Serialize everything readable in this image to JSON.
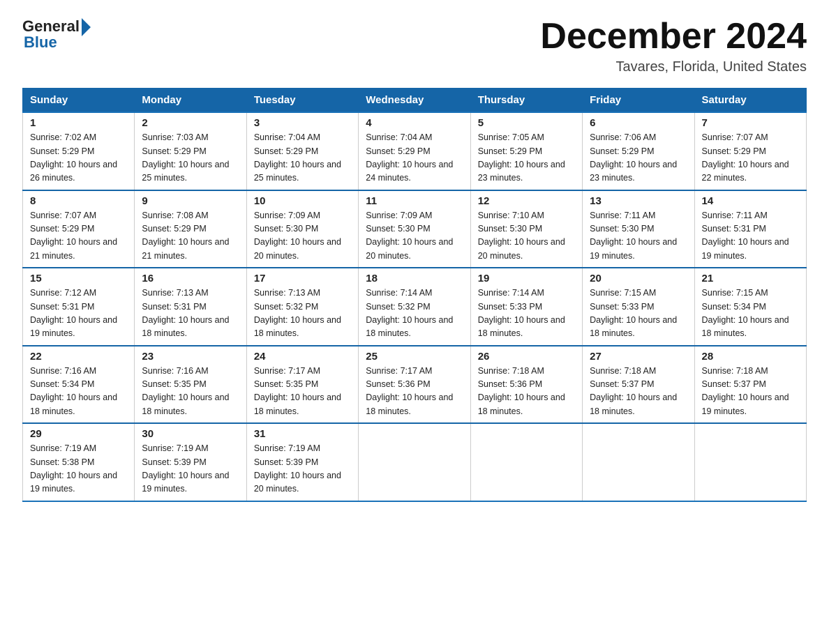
{
  "logo": {
    "general": "General",
    "blue": "Blue"
  },
  "header": {
    "month": "December 2024",
    "location": "Tavares, Florida, United States"
  },
  "days_of_week": [
    "Sunday",
    "Monday",
    "Tuesday",
    "Wednesday",
    "Thursday",
    "Friday",
    "Saturday"
  ],
  "weeks": [
    [
      {
        "num": "1",
        "sunrise": "7:02 AM",
        "sunset": "5:29 PM",
        "daylight": "10 hours and 26 minutes."
      },
      {
        "num": "2",
        "sunrise": "7:03 AM",
        "sunset": "5:29 PM",
        "daylight": "10 hours and 25 minutes."
      },
      {
        "num": "3",
        "sunrise": "7:04 AM",
        "sunset": "5:29 PM",
        "daylight": "10 hours and 25 minutes."
      },
      {
        "num": "4",
        "sunrise": "7:04 AM",
        "sunset": "5:29 PM",
        "daylight": "10 hours and 24 minutes."
      },
      {
        "num": "5",
        "sunrise": "7:05 AM",
        "sunset": "5:29 PM",
        "daylight": "10 hours and 23 minutes."
      },
      {
        "num": "6",
        "sunrise": "7:06 AM",
        "sunset": "5:29 PM",
        "daylight": "10 hours and 23 minutes."
      },
      {
        "num": "7",
        "sunrise": "7:07 AM",
        "sunset": "5:29 PM",
        "daylight": "10 hours and 22 minutes."
      }
    ],
    [
      {
        "num": "8",
        "sunrise": "7:07 AM",
        "sunset": "5:29 PM",
        "daylight": "10 hours and 21 minutes."
      },
      {
        "num": "9",
        "sunrise": "7:08 AM",
        "sunset": "5:29 PM",
        "daylight": "10 hours and 21 minutes."
      },
      {
        "num": "10",
        "sunrise": "7:09 AM",
        "sunset": "5:30 PM",
        "daylight": "10 hours and 20 minutes."
      },
      {
        "num": "11",
        "sunrise": "7:09 AM",
        "sunset": "5:30 PM",
        "daylight": "10 hours and 20 minutes."
      },
      {
        "num": "12",
        "sunrise": "7:10 AM",
        "sunset": "5:30 PM",
        "daylight": "10 hours and 20 minutes."
      },
      {
        "num": "13",
        "sunrise": "7:11 AM",
        "sunset": "5:30 PM",
        "daylight": "10 hours and 19 minutes."
      },
      {
        "num": "14",
        "sunrise": "7:11 AM",
        "sunset": "5:31 PM",
        "daylight": "10 hours and 19 minutes."
      }
    ],
    [
      {
        "num": "15",
        "sunrise": "7:12 AM",
        "sunset": "5:31 PM",
        "daylight": "10 hours and 19 minutes."
      },
      {
        "num": "16",
        "sunrise": "7:13 AM",
        "sunset": "5:31 PM",
        "daylight": "10 hours and 18 minutes."
      },
      {
        "num": "17",
        "sunrise": "7:13 AM",
        "sunset": "5:32 PM",
        "daylight": "10 hours and 18 minutes."
      },
      {
        "num": "18",
        "sunrise": "7:14 AM",
        "sunset": "5:32 PM",
        "daylight": "10 hours and 18 minutes."
      },
      {
        "num": "19",
        "sunrise": "7:14 AM",
        "sunset": "5:33 PM",
        "daylight": "10 hours and 18 minutes."
      },
      {
        "num": "20",
        "sunrise": "7:15 AM",
        "sunset": "5:33 PM",
        "daylight": "10 hours and 18 minutes."
      },
      {
        "num": "21",
        "sunrise": "7:15 AM",
        "sunset": "5:34 PM",
        "daylight": "10 hours and 18 minutes."
      }
    ],
    [
      {
        "num": "22",
        "sunrise": "7:16 AM",
        "sunset": "5:34 PM",
        "daylight": "10 hours and 18 minutes."
      },
      {
        "num": "23",
        "sunrise": "7:16 AM",
        "sunset": "5:35 PM",
        "daylight": "10 hours and 18 minutes."
      },
      {
        "num": "24",
        "sunrise": "7:17 AM",
        "sunset": "5:35 PM",
        "daylight": "10 hours and 18 minutes."
      },
      {
        "num": "25",
        "sunrise": "7:17 AM",
        "sunset": "5:36 PM",
        "daylight": "10 hours and 18 minutes."
      },
      {
        "num": "26",
        "sunrise": "7:18 AM",
        "sunset": "5:36 PM",
        "daylight": "10 hours and 18 minutes."
      },
      {
        "num": "27",
        "sunrise": "7:18 AM",
        "sunset": "5:37 PM",
        "daylight": "10 hours and 18 minutes."
      },
      {
        "num": "28",
        "sunrise": "7:18 AM",
        "sunset": "5:37 PM",
        "daylight": "10 hours and 19 minutes."
      }
    ],
    [
      {
        "num": "29",
        "sunrise": "7:19 AM",
        "sunset": "5:38 PM",
        "daylight": "10 hours and 19 minutes."
      },
      {
        "num": "30",
        "sunrise": "7:19 AM",
        "sunset": "5:39 PM",
        "daylight": "10 hours and 19 minutes."
      },
      {
        "num": "31",
        "sunrise": "7:19 AM",
        "sunset": "5:39 PM",
        "daylight": "10 hours and 20 minutes."
      },
      null,
      null,
      null,
      null
    ]
  ]
}
